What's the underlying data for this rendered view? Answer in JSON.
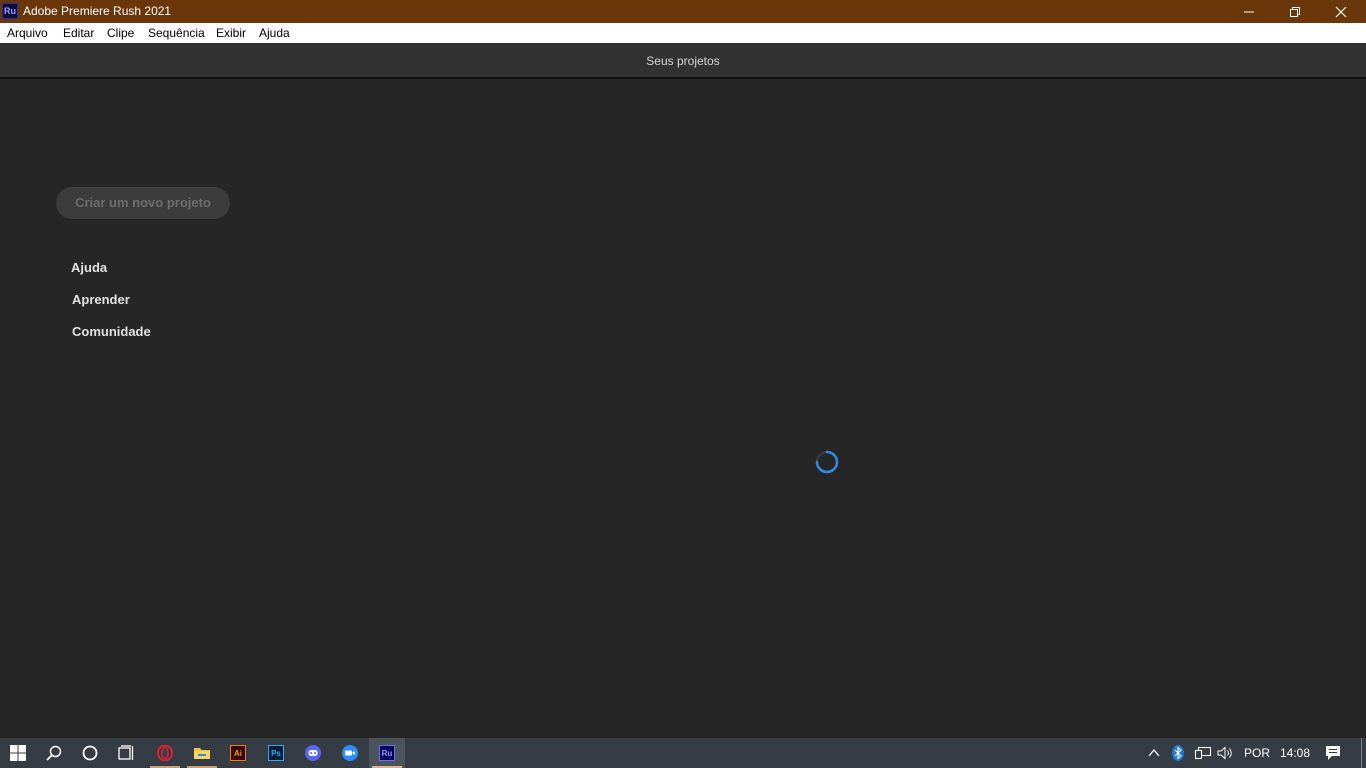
{
  "window": {
    "app_icon_label": "Ru",
    "title": "Adobe Premiere Rush 2021"
  },
  "menu": {
    "items": [
      "Arquivo",
      "Editar",
      "Clipe",
      "Sequência",
      "Exibir",
      "Ajuda"
    ]
  },
  "header": {
    "title": "Seus projetos"
  },
  "main": {
    "create_button": "Criar um novo projeto",
    "links": [
      "Ajuda",
      "Aprender",
      "Comunidade"
    ],
    "loading": true
  },
  "taskbar": {
    "apps": [
      {
        "name": "opera-icon"
      },
      {
        "name": "file-explorer-icon"
      },
      {
        "name": "illustrator-icon",
        "label": "Ai"
      },
      {
        "name": "photoshop-icon",
        "label": "Ps"
      },
      {
        "name": "discord-icon"
      },
      {
        "name": "zoom-icon"
      },
      {
        "name": "premiere-rush-icon",
        "label": "Ru",
        "active": true
      }
    ],
    "language": "POR",
    "time": "14:08"
  },
  "colors": {
    "titlebar": "#6b3609",
    "background": "#262626",
    "header": "#323232",
    "spinner": "#2d8ceb",
    "taskbar": "#353c43"
  }
}
